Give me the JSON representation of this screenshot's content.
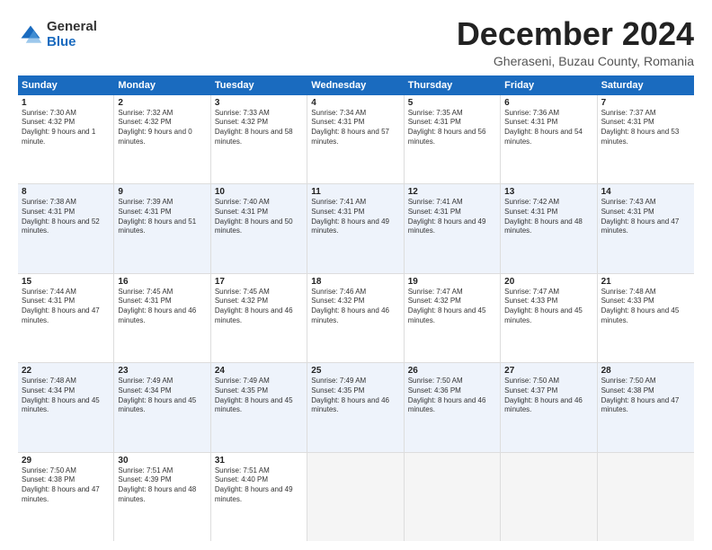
{
  "logo": {
    "general": "General",
    "blue": "Blue"
  },
  "title": "December 2024",
  "subtitle": "Gheraseni, Buzau County, Romania",
  "days": [
    "Sunday",
    "Monday",
    "Tuesday",
    "Wednesday",
    "Thursday",
    "Friday",
    "Saturday"
  ],
  "weeks": [
    [
      {
        "day": "1",
        "sunrise": "Sunrise: 7:30 AM",
        "sunset": "Sunset: 4:32 PM",
        "daylight": "Daylight: 9 hours and 1 minute."
      },
      {
        "day": "2",
        "sunrise": "Sunrise: 7:32 AM",
        "sunset": "Sunset: 4:32 PM",
        "daylight": "Daylight: 9 hours and 0 minutes."
      },
      {
        "day": "3",
        "sunrise": "Sunrise: 7:33 AM",
        "sunset": "Sunset: 4:32 PM",
        "daylight": "Daylight: 8 hours and 58 minutes."
      },
      {
        "day": "4",
        "sunrise": "Sunrise: 7:34 AM",
        "sunset": "Sunset: 4:31 PM",
        "daylight": "Daylight: 8 hours and 57 minutes."
      },
      {
        "day": "5",
        "sunrise": "Sunrise: 7:35 AM",
        "sunset": "Sunset: 4:31 PM",
        "daylight": "Daylight: 8 hours and 56 minutes."
      },
      {
        "day": "6",
        "sunrise": "Sunrise: 7:36 AM",
        "sunset": "Sunset: 4:31 PM",
        "daylight": "Daylight: 8 hours and 54 minutes."
      },
      {
        "day": "7",
        "sunrise": "Sunrise: 7:37 AM",
        "sunset": "Sunset: 4:31 PM",
        "daylight": "Daylight: 8 hours and 53 minutes."
      }
    ],
    [
      {
        "day": "8",
        "sunrise": "Sunrise: 7:38 AM",
        "sunset": "Sunset: 4:31 PM",
        "daylight": "Daylight: 8 hours and 52 minutes."
      },
      {
        "day": "9",
        "sunrise": "Sunrise: 7:39 AM",
        "sunset": "Sunset: 4:31 PM",
        "daylight": "Daylight: 8 hours and 51 minutes."
      },
      {
        "day": "10",
        "sunrise": "Sunrise: 7:40 AM",
        "sunset": "Sunset: 4:31 PM",
        "daylight": "Daylight: 8 hours and 50 minutes."
      },
      {
        "day": "11",
        "sunrise": "Sunrise: 7:41 AM",
        "sunset": "Sunset: 4:31 PM",
        "daylight": "Daylight: 8 hours and 49 minutes."
      },
      {
        "day": "12",
        "sunrise": "Sunrise: 7:41 AM",
        "sunset": "Sunset: 4:31 PM",
        "daylight": "Daylight: 8 hours and 49 minutes."
      },
      {
        "day": "13",
        "sunrise": "Sunrise: 7:42 AM",
        "sunset": "Sunset: 4:31 PM",
        "daylight": "Daylight: 8 hours and 48 minutes."
      },
      {
        "day": "14",
        "sunrise": "Sunrise: 7:43 AM",
        "sunset": "Sunset: 4:31 PM",
        "daylight": "Daylight: 8 hours and 47 minutes."
      }
    ],
    [
      {
        "day": "15",
        "sunrise": "Sunrise: 7:44 AM",
        "sunset": "Sunset: 4:31 PM",
        "daylight": "Daylight: 8 hours and 47 minutes."
      },
      {
        "day": "16",
        "sunrise": "Sunrise: 7:45 AM",
        "sunset": "Sunset: 4:31 PM",
        "daylight": "Daylight: 8 hours and 46 minutes."
      },
      {
        "day": "17",
        "sunrise": "Sunrise: 7:45 AM",
        "sunset": "Sunset: 4:32 PM",
        "daylight": "Daylight: 8 hours and 46 minutes."
      },
      {
        "day": "18",
        "sunrise": "Sunrise: 7:46 AM",
        "sunset": "Sunset: 4:32 PM",
        "daylight": "Daylight: 8 hours and 46 minutes."
      },
      {
        "day": "19",
        "sunrise": "Sunrise: 7:47 AM",
        "sunset": "Sunset: 4:32 PM",
        "daylight": "Daylight: 8 hours and 45 minutes."
      },
      {
        "day": "20",
        "sunrise": "Sunrise: 7:47 AM",
        "sunset": "Sunset: 4:33 PM",
        "daylight": "Daylight: 8 hours and 45 minutes."
      },
      {
        "day": "21",
        "sunrise": "Sunrise: 7:48 AM",
        "sunset": "Sunset: 4:33 PM",
        "daylight": "Daylight: 8 hours and 45 minutes."
      }
    ],
    [
      {
        "day": "22",
        "sunrise": "Sunrise: 7:48 AM",
        "sunset": "Sunset: 4:34 PM",
        "daylight": "Daylight: 8 hours and 45 minutes."
      },
      {
        "day": "23",
        "sunrise": "Sunrise: 7:49 AM",
        "sunset": "Sunset: 4:34 PM",
        "daylight": "Daylight: 8 hours and 45 minutes."
      },
      {
        "day": "24",
        "sunrise": "Sunrise: 7:49 AM",
        "sunset": "Sunset: 4:35 PM",
        "daylight": "Daylight: 8 hours and 45 minutes."
      },
      {
        "day": "25",
        "sunrise": "Sunrise: 7:49 AM",
        "sunset": "Sunset: 4:35 PM",
        "daylight": "Daylight: 8 hours and 46 minutes."
      },
      {
        "day": "26",
        "sunrise": "Sunrise: 7:50 AM",
        "sunset": "Sunset: 4:36 PM",
        "daylight": "Daylight: 8 hours and 46 minutes."
      },
      {
        "day": "27",
        "sunrise": "Sunrise: 7:50 AM",
        "sunset": "Sunset: 4:37 PM",
        "daylight": "Daylight: 8 hours and 46 minutes."
      },
      {
        "day": "28",
        "sunrise": "Sunrise: 7:50 AM",
        "sunset": "Sunset: 4:38 PM",
        "daylight": "Daylight: 8 hours and 47 minutes."
      }
    ],
    [
      {
        "day": "29",
        "sunrise": "Sunrise: 7:50 AM",
        "sunset": "Sunset: 4:38 PM",
        "daylight": "Daylight: 8 hours and 47 minutes."
      },
      {
        "day": "30",
        "sunrise": "Sunrise: 7:51 AM",
        "sunset": "Sunset: 4:39 PM",
        "daylight": "Daylight: 8 hours and 48 minutes."
      },
      {
        "day": "31",
        "sunrise": "Sunrise: 7:51 AM",
        "sunset": "Sunset: 4:40 PM",
        "daylight": "Daylight: 8 hours and 49 minutes."
      },
      null,
      null,
      null,
      null
    ]
  ]
}
